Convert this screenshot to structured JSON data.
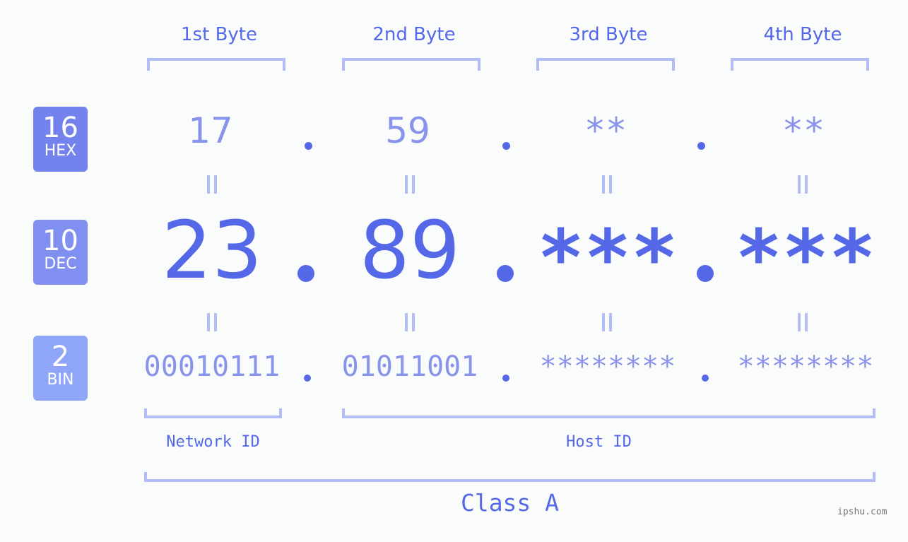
{
  "headers": [
    "1st Byte",
    "2nd Byte",
    "3rd Byte",
    "4th Byte"
  ],
  "bases": [
    {
      "number": "16",
      "label": "HEX",
      "color": "#7382ec"
    },
    {
      "number": "10",
      "label": "DEC",
      "color": "#8190f0"
    },
    {
      "number": "2",
      "label": "BIN",
      "color": "#8fa6f8"
    }
  ],
  "hex": [
    "17",
    "59",
    "**",
    "**"
  ],
  "dec": [
    "23",
    "89",
    "***",
    "***"
  ],
  "bin": [
    "00010111",
    "01011001",
    "********",
    "********"
  ],
  "separator": ".",
  "network_id_label": "Network ID",
  "host_id_label": "Host ID",
  "class_label": "Class A",
  "watermark": "ipshu.com",
  "colors": {
    "primary": "#5468e8",
    "light": "#8893ec",
    "bracket": "#b3bdf5"
  }
}
